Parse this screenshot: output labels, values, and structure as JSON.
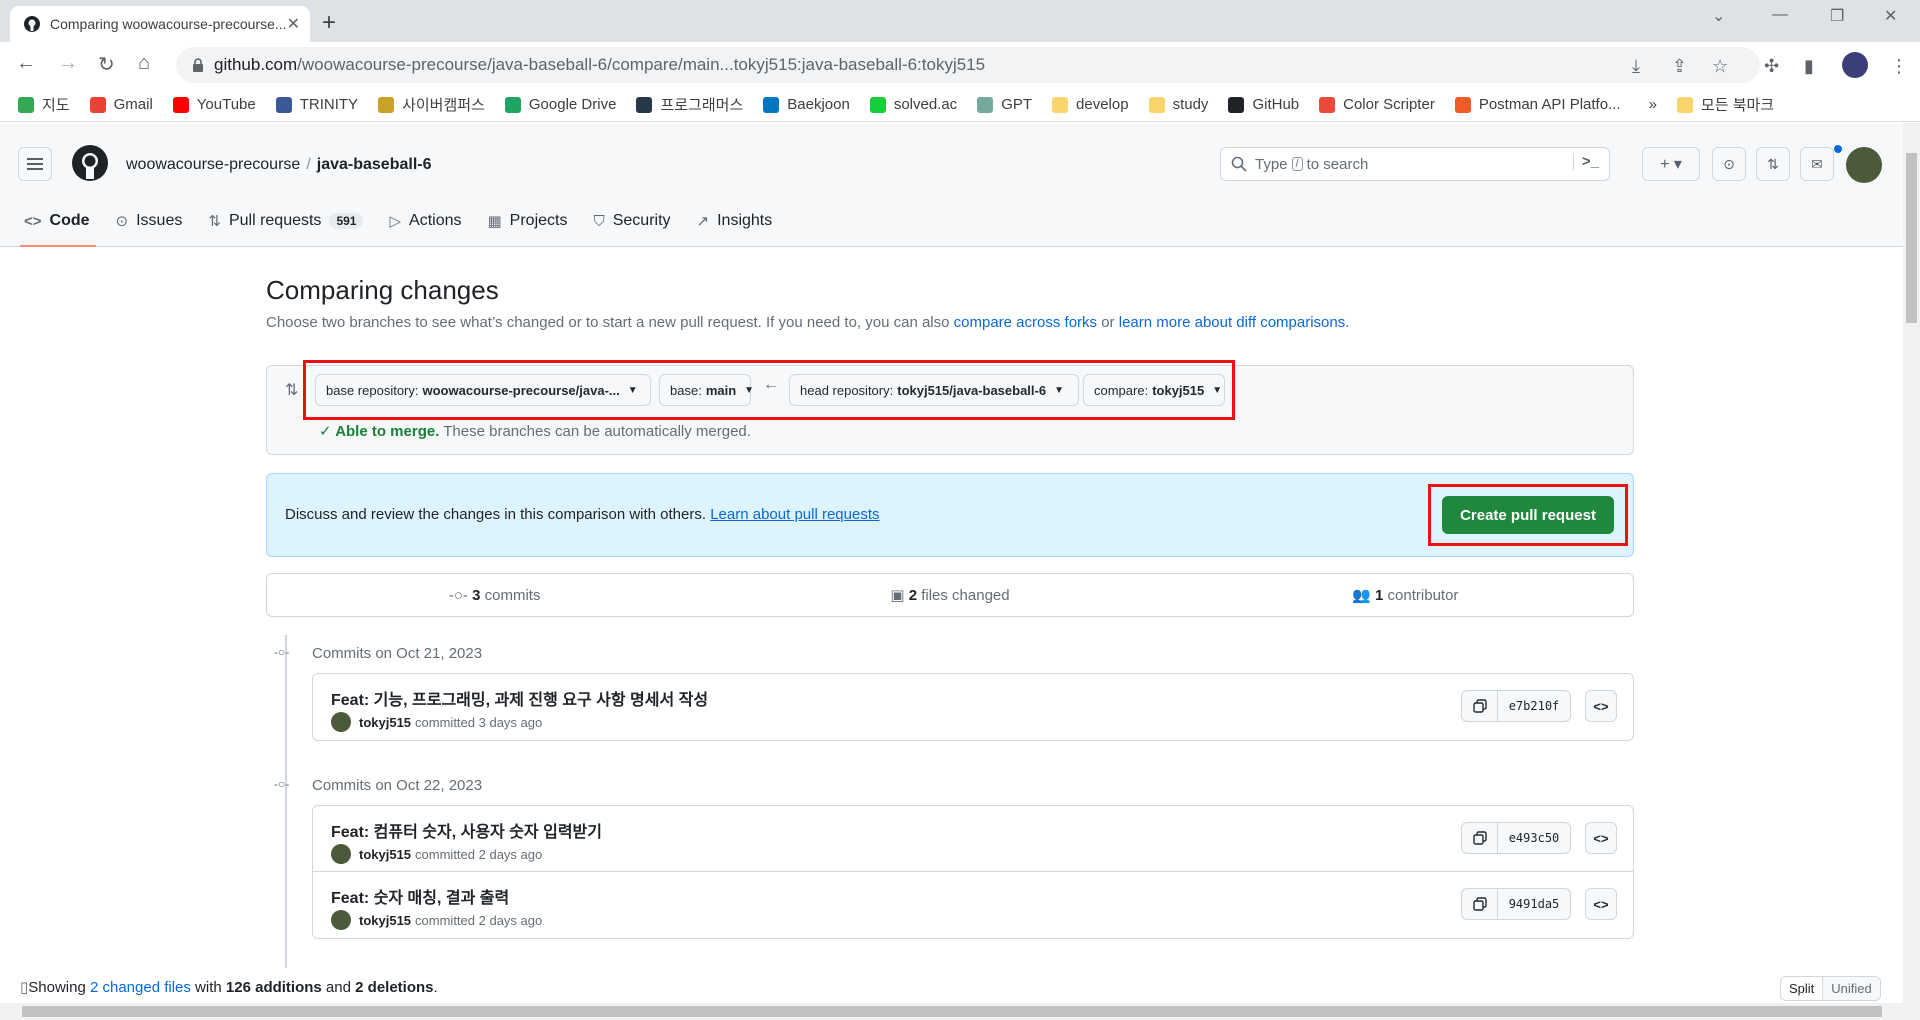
{
  "browser": {
    "tab_title": "Comparing woowacourse-precourse...",
    "url_host": "github.com",
    "url_path": "/woowacourse-precourse/java-baseball-6/compare/main...tokyj515:java-baseball-6:tokyj515"
  },
  "bookmarks": [
    {
      "label": "지도",
      "color": "#34a853"
    },
    {
      "label": "Gmail",
      "color": "#ea4335"
    },
    {
      "label": "YouTube",
      "color": "#ff0000"
    },
    {
      "label": "TRINITY",
      "color": "#3b5998"
    },
    {
      "label": "사이버캠퍼스",
      "color": "#c9a227"
    },
    {
      "label": "Google Drive",
      "color": "#1fa463"
    },
    {
      "label": "프로그래머스",
      "color": "#263747"
    },
    {
      "label": "Baekjoon",
      "color": "#0076c0"
    },
    {
      "label": "solved.ac",
      "color": "#17ce3a"
    },
    {
      "label": "GPT",
      "color": "#74aa9c"
    },
    {
      "label": "develop",
      "color": "#f7d56b"
    },
    {
      "label": "study",
      "color": "#f7d56b"
    },
    {
      "label": "GitHub",
      "color": "#1f2328"
    },
    {
      "label": "Color Scripter",
      "color": "#e84a3b"
    },
    {
      "label": "Postman API Platfo...",
      "color": "#ef5b25"
    }
  ],
  "bookmarks_more": "»",
  "bookmarks_all": "모든 북마크",
  "github": {
    "owner": "woowacourse-precourse",
    "separator": "/",
    "repo": "java-baseball-6",
    "search_prefix": "Type",
    "search_key": "/",
    "search_suffix": "to search",
    "nav": [
      {
        "label": "Code",
        "icon": "code-icon",
        "glyph": "<>"
      },
      {
        "label": "Issues",
        "icon": "issue-icon",
        "glyph": "⊙"
      },
      {
        "label": "Pull requests",
        "icon": "pull-request-icon",
        "glyph": "⇅",
        "count": "591"
      },
      {
        "label": "Actions",
        "icon": "play-icon",
        "glyph": "▷"
      },
      {
        "label": "Projects",
        "icon": "table-icon",
        "glyph": "▦"
      },
      {
        "label": "Security",
        "icon": "shield-icon",
        "glyph": "⛉"
      },
      {
        "label": "Insights",
        "icon": "graph-icon",
        "glyph": "↗"
      }
    ]
  },
  "compare": {
    "title": "Comparing changes",
    "desc_text": "Choose two branches to see what’s changed or to start a new pull request. If you need to, you can also ",
    "desc_link1": "compare across forks",
    "desc_or": " or ",
    "desc_link2": "learn more about diff comparisons",
    "desc_end": ".",
    "base_repo_label": "base repository:",
    "base_repo_value": "woowacourse-precourse/java-...",
    "base_label": "base:",
    "base_value": "main",
    "head_repo_label": "head repository:",
    "head_repo_value": "tokyj515/java-baseball-6",
    "compare_label": "compare:",
    "compare_value": "tokyj515",
    "merge_ok": "Able to merge.",
    "merge_text": " These branches can be automatically merged.",
    "discuss_text": "Discuss and review the changes in this comparison with others. ",
    "discuss_link": "Learn about pull requests",
    "create_pr": "Create pull request",
    "stats": {
      "commits_num": "3",
      "commits_label": " commits",
      "files_num": "2",
      "files_label": " files changed",
      "contrib_num": "1",
      "contrib_label": " contributor"
    }
  },
  "commit_groups": [
    {
      "date": "Commits on Oct 21, 2023",
      "commits": [
        {
          "message": "Feat: 기능, 프로그래밍, 과제 진행 요구 사항 명세서 작성",
          "author": "tokyj515",
          "when": "committed 3 days ago",
          "sha": "e7b210f"
        }
      ]
    },
    {
      "date": "Commits on Oct 22, 2023",
      "commits": [
        {
          "message": "Feat: 컴퓨터 숫자, 사용자 숫자 입력받기",
          "author": "tokyj515",
          "when": "committed 2 days ago",
          "sha": "e493c50"
        },
        {
          "message": "Feat: 숫자 매칭, 결과 출력",
          "author": "tokyj515",
          "when": "committed 2 days ago",
          "sha": "9491da5"
        }
      ]
    }
  ],
  "footer": {
    "showing": "Showing ",
    "files_link": "2 changed files",
    "with": " with ",
    "additions": "126 additions",
    "and": " and ",
    "deletions": "2 deletions",
    "end": ".",
    "split": "Split",
    "unified": "Unified"
  }
}
